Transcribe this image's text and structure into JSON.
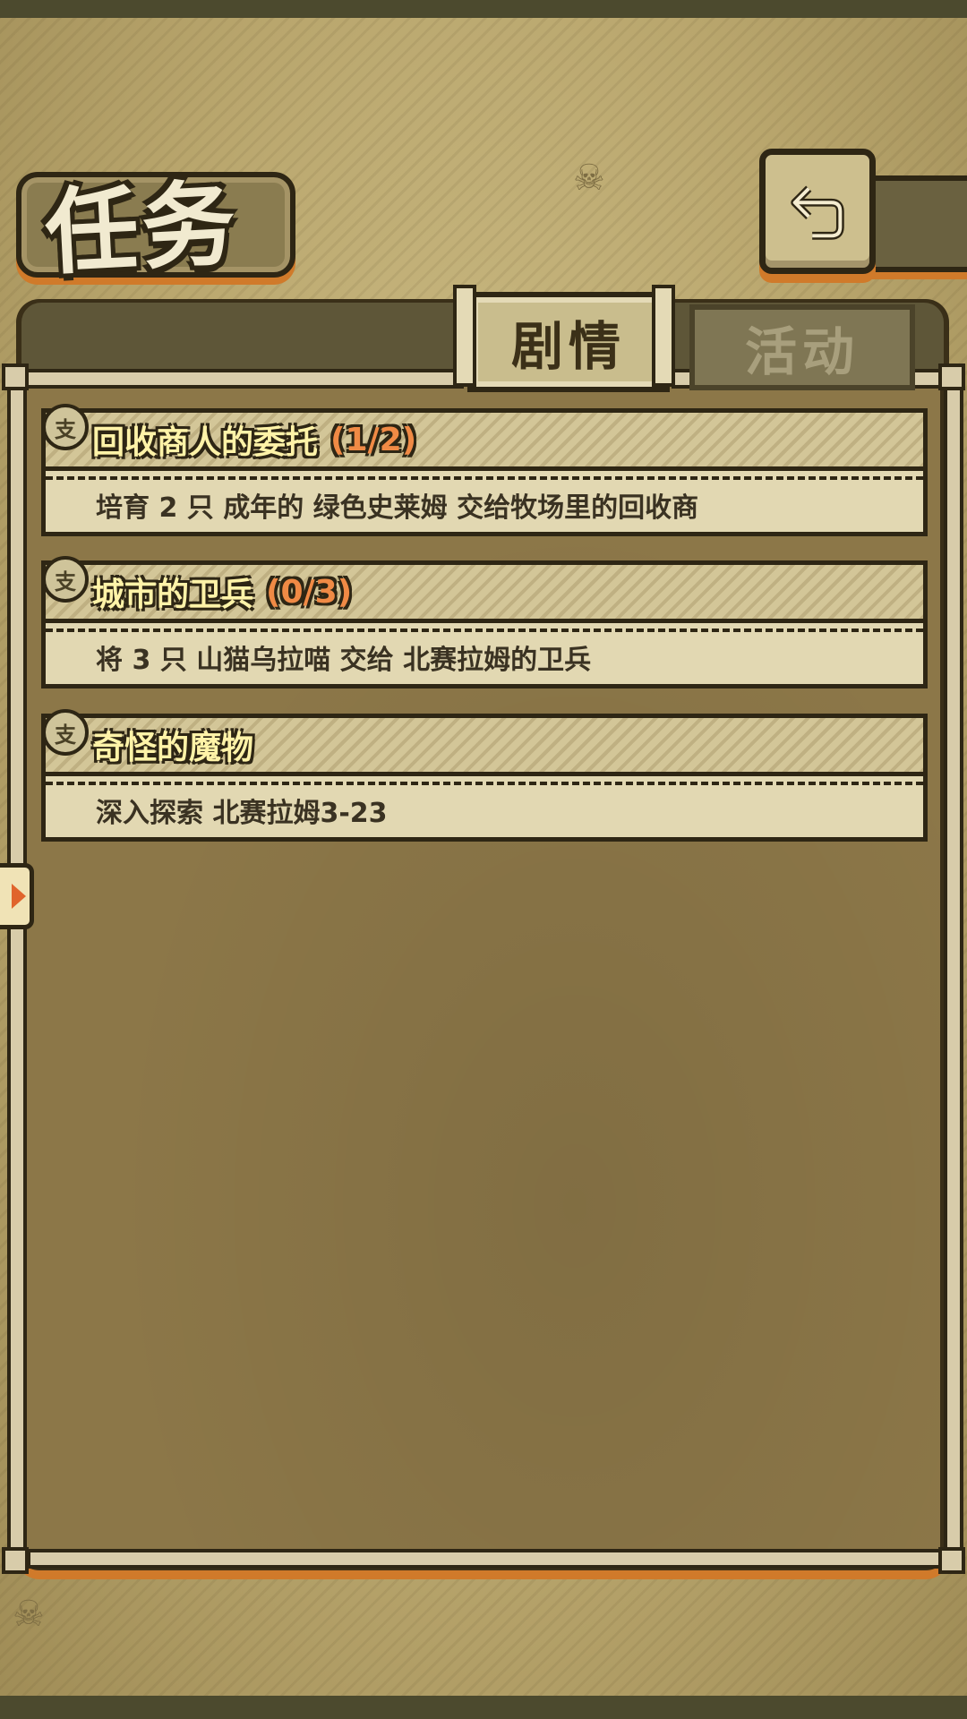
{
  "header": {
    "title": "任务",
    "back_icon": "back-arrow-icon"
  },
  "tabs": [
    {
      "label": "剧情",
      "active": true
    },
    {
      "label": "活动",
      "active": false
    }
  ],
  "quests": [
    {
      "badge": "支",
      "title": "回收商人的委托",
      "progress": "(1/2)",
      "description": "培育 2 只 成年的 绿色史莱姆 交给牧场里的回收商"
    },
    {
      "badge": "支",
      "title": "城市的卫兵",
      "progress": "(0/3)",
      "description": "将 3 只 山猫乌拉喵 交给 北赛拉姆的卫兵"
    },
    {
      "badge": "支",
      "title": "奇怪的魔物",
      "progress": "",
      "description": "深入探索 北赛拉姆3-23"
    }
  ],
  "colors": {
    "frame": "#2e2614",
    "accent_orange": "#d07a2a",
    "quest_title": "#fff3a8",
    "quest_progress": "#f08a45"
  }
}
